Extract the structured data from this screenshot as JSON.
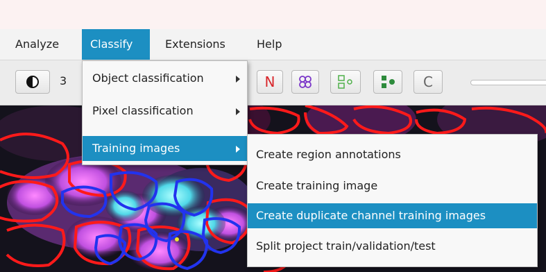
{
  "menubar": {
    "items": [
      "Analyze",
      "Classify",
      "Extensions",
      "Help"
    ],
    "active": "Classify"
  },
  "toolbar": {
    "partial_text": "3",
    "buttons": [
      {
        "icon": "contrast-icon"
      },
      {
        "label": "N",
        "color": "#d8262b"
      },
      {
        "icon": "detections-icon",
        "color": "#7a35c8"
      },
      {
        "icon": "tma-grid-icon",
        "color": "#4fb04a"
      },
      {
        "icon": "annotation-icon",
        "color": "#2e8b3c"
      },
      {
        "label": "C",
        "color": "#666666"
      }
    ]
  },
  "classify_menu": {
    "items": [
      {
        "label": "Object classification",
        "has_submenu": true
      },
      {
        "label": "Pixel classification",
        "has_submenu": true
      },
      {
        "label": "Training images",
        "has_submenu": true,
        "selected": true
      }
    ]
  },
  "training_submenu": {
    "items": [
      {
        "label": "Create region annotations"
      },
      {
        "label": "Create training image"
      },
      {
        "label": "Create duplicate channel training images",
        "selected": true
      },
      {
        "label": "Split project train/validation/test"
      }
    ]
  },
  "colors": {
    "menu_highlight": "#1c8fc2",
    "cell_outline_red": "#ff1a1a",
    "cell_outline_blue": "#2233ee",
    "nucleus_magenta": "#e070ff",
    "nucleus_cyan": "#5fe8f0"
  }
}
